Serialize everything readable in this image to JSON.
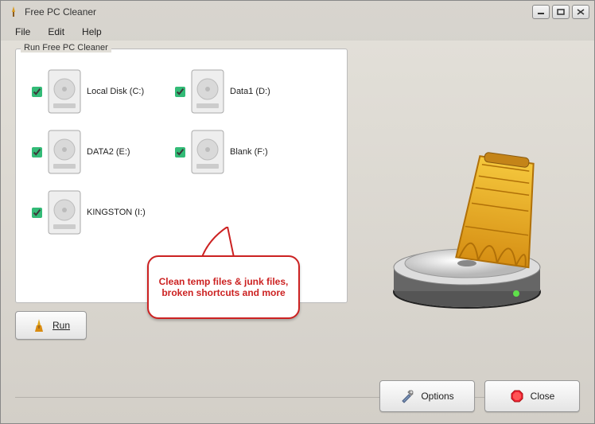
{
  "window": {
    "title": "Free PC Cleaner"
  },
  "menu": {
    "file": "File",
    "edit": "Edit",
    "help": "Help"
  },
  "group": {
    "legend": "Run Free PC Cleaner"
  },
  "drives": [
    {
      "label": "Local Disk (C:)",
      "checked": true
    },
    {
      "label": "Data1 (D:)",
      "checked": true
    },
    {
      "label": "DATA2 (E:)",
      "checked": true
    },
    {
      "label": "Blank (F:)",
      "checked": true
    },
    {
      "label": "KINGSTON (I:)",
      "checked": true
    }
  ],
  "callout": {
    "text": "Clean temp files & junk files, broken shortcuts and more"
  },
  "buttons": {
    "run": "Run",
    "options": "Options",
    "close": "Close"
  }
}
